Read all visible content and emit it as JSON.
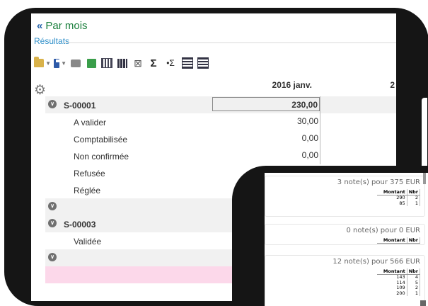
{
  "header": {
    "back_chevron": "«",
    "title": "Par mois",
    "subtitle": "Résultats"
  },
  "toolbar": {
    "icons": [
      "folder-open-icon",
      "save-icon",
      "print-icon",
      "excel-icon",
      "columns-icon",
      "bars-icon",
      "cross-table-icon",
      "sum-icon",
      "sum-arrow-icon",
      "grid-icon",
      "grid-alt-icon"
    ],
    "dd": "▼",
    "sum": "Σ",
    "sum_arrow": "•Σ"
  },
  "grid": {
    "col_first": "2016 janv.",
    "col_second": "2",
    "rows": [
      {
        "type": "group",
        "label": "S-00001",
        "value": "230,00",
        "selected": true
      },
      {
        "type": "child",
        "label": "A valider",
        "value": "30,00"
      },
      {
        "type": "child",
        "label": "Comptabilisée",
        "value": "0,00"
      },
      {
        "type": "child",
        "label": "Non confirmée",
        "value": "0,00"
      },
      {
        "type": "child",
        "label": "Refusée",
        "value": ""
      },
      {
        "type": "child",
        "label": "Réglée",
        "value": ""
      },
      {
        "type": "group",
        "label": "",
        "value": ""
      },
      {
        "type": "group",
        "label": "S-00003",
        "value": ""
      },
      {
        "type": "child",
        "label": "Validée",
        "value": ""
      },
      {
        "type": "group",
        "label": "",
        "value": ""
      },
      {
        "type": "pink",
        "label": "",
        "value": ""
      }
    ]
  },
  "notes": [
    {
      "summary": "3 note(s) pour 375 EUR",
      "col_montant": "Montant",
      "col_nbr": "Nbr",
      "rows": [
        [
          "290",
          "2"
        ],
        [
          "85",
          "1"
        ]
      ]
    },
    {
      "summary": "0 note(s) pour 0 EUR",
      "col_montant": "Montant",
      "col_nbr": "Nbr",
      "rows": []
    },
    {
      "summary": "12 note(s) pour 566 EUR",
      "col_montant": "Montant",
      "col_nbr": "Nbr",
      "rows": [
        [
          "143",
          "4"
        ],
        [
          "114",
          "5"
        ],
        [
          "109",
          "2"
        ],
        [
          "200",
          "1"
        ]
      ]
    }
  ]
}
